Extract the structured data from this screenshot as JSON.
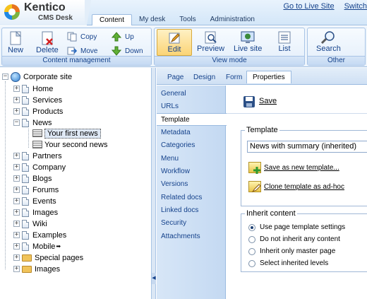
{
  "app": {
    "brand": "Kentico",
    "product": "CMS Desk"
  },
  "top_tabs": [
    {
      "label": "Content",
      "active": true
    },
    {
      "label": "My desk",
      "active": false
    },
    {
      "label": "Tools",
      "active": false
    },
    {
      "label": "Administration",
      "active": false
    }
  ],
  "top_links": {
    "live_site": "Go to Live Site",
    "switch": "Switch"
  },
  "ribbon": {
    "content_management": {
      "label": "Content management",
      "new": "New",
      "delete": "Delete",
      "copy": "Copy",
      "move": "Move",
      "up": "Up",
      "down": "Down"
    },
    "view_mode": {
      "label": "View mode",
      "edit": "Edit",
      "preview": "Preview",
      "live_site": "Live site",
      "list": "List",
      "active": "Edit"
    },
    "other": {
      "label": "Other",
      "search": "Search"
    }
  },
  "tree": {
    "root": "Corporate site",
    "items": [
      {
        "label": "Home",
        "type": "doc"
      },
      {
        "label": "Services",
        "type": "doc"
      },
      {
        "label": "Products",
        "type": "doc"
      },
      {
        "label": "News",
        "type": "doc",
        "expanded": true
      },
      {
        "label": "Your first news",
        "type": "news",
        "selected": true
      },
      {
        "label": "Your second news",
        "type": "news"
      },
      {
        "label": "Partners",
        "type": "doc"
      },
      {
        "label": "Company",
        "type": "doc"
      },
      {
        "label": "Blogs",
        "type": "doc"
      },
      {
        "label": "Forums",
        "type": "doc"
      },
      {
        "label": "Events",
        "type": "doc"
      },
      {
        "label": "Images",
        "type": "doc"
      },
      {
        "label": "Wiki",
        "type": "doc"
      },
      {
        "label": "Examples",
        "type": "doc"
      },
      {
        "label": "Mobile",
        "type": "doc"
      },
      {
        "label": "Special pages",
        "type": "folder"
      },
      {
        "label": "Images",
        "type": "folder"
      }
    ]
  },
  "sub_tabs": [
    {
      "label": "Page",
      "active": false
    },
    {
      "label": "Design",
      "active": false
    },
    {
      "label": "Form",
      "active": false
    },
    {
      "label": "Properties",
      "active": true
    }
  ],
  "properties_menu": [
    {
      "label": "General",
      "active": false
    },
    {
      "label": "URLs",
      "active": false
    },
    {
      "label": "Template",
      "active": true
    },
    {
      "label": "Metadata",
      "active": false
    },
    {
      "label": "Categories",
      "active": false
    },
    {
      "label": "Menu",
      "active": false
    },
    {
      "label": "Workflow",
      "active": false
    },
    {
      "label": "Versions",
      "active": false
    },
    {
      "label": "Related docs",
      "active": false
    },
    {
      "label": "Linked docs",
      "active": false
    },
    {
      "label": "Security",
      "active": false
    },
    {
      "label": "Attachments",
      "active": false
    }
  ],
  "content": {
    "save": "Save",
    "template_legend": "Template",
    "template_value": "News with summary (inherited)",
    "save_as_new": "Save as new template...",
    "clone_adhoc": "Clone template as ad-hoc",
    "inherit_legend": "Inherit content",
    "inherit_options": [
      {
        "label": "Use page template settings",
        "checked": true
      },
      {
        "label": "Do not inherit any content",
        "checked": false
      },
      {
        "label": "Inherit only master page",
        "checked": false
      },
      {
        "label": "Select inherited levels",
        "checked": false
      }
    ]
  },
  "colors": {
    "accent": "#15428b",
    "active_tab_highlight": "#fbd476",
    "panel_blue": "#d3e6f8"
  }
}
